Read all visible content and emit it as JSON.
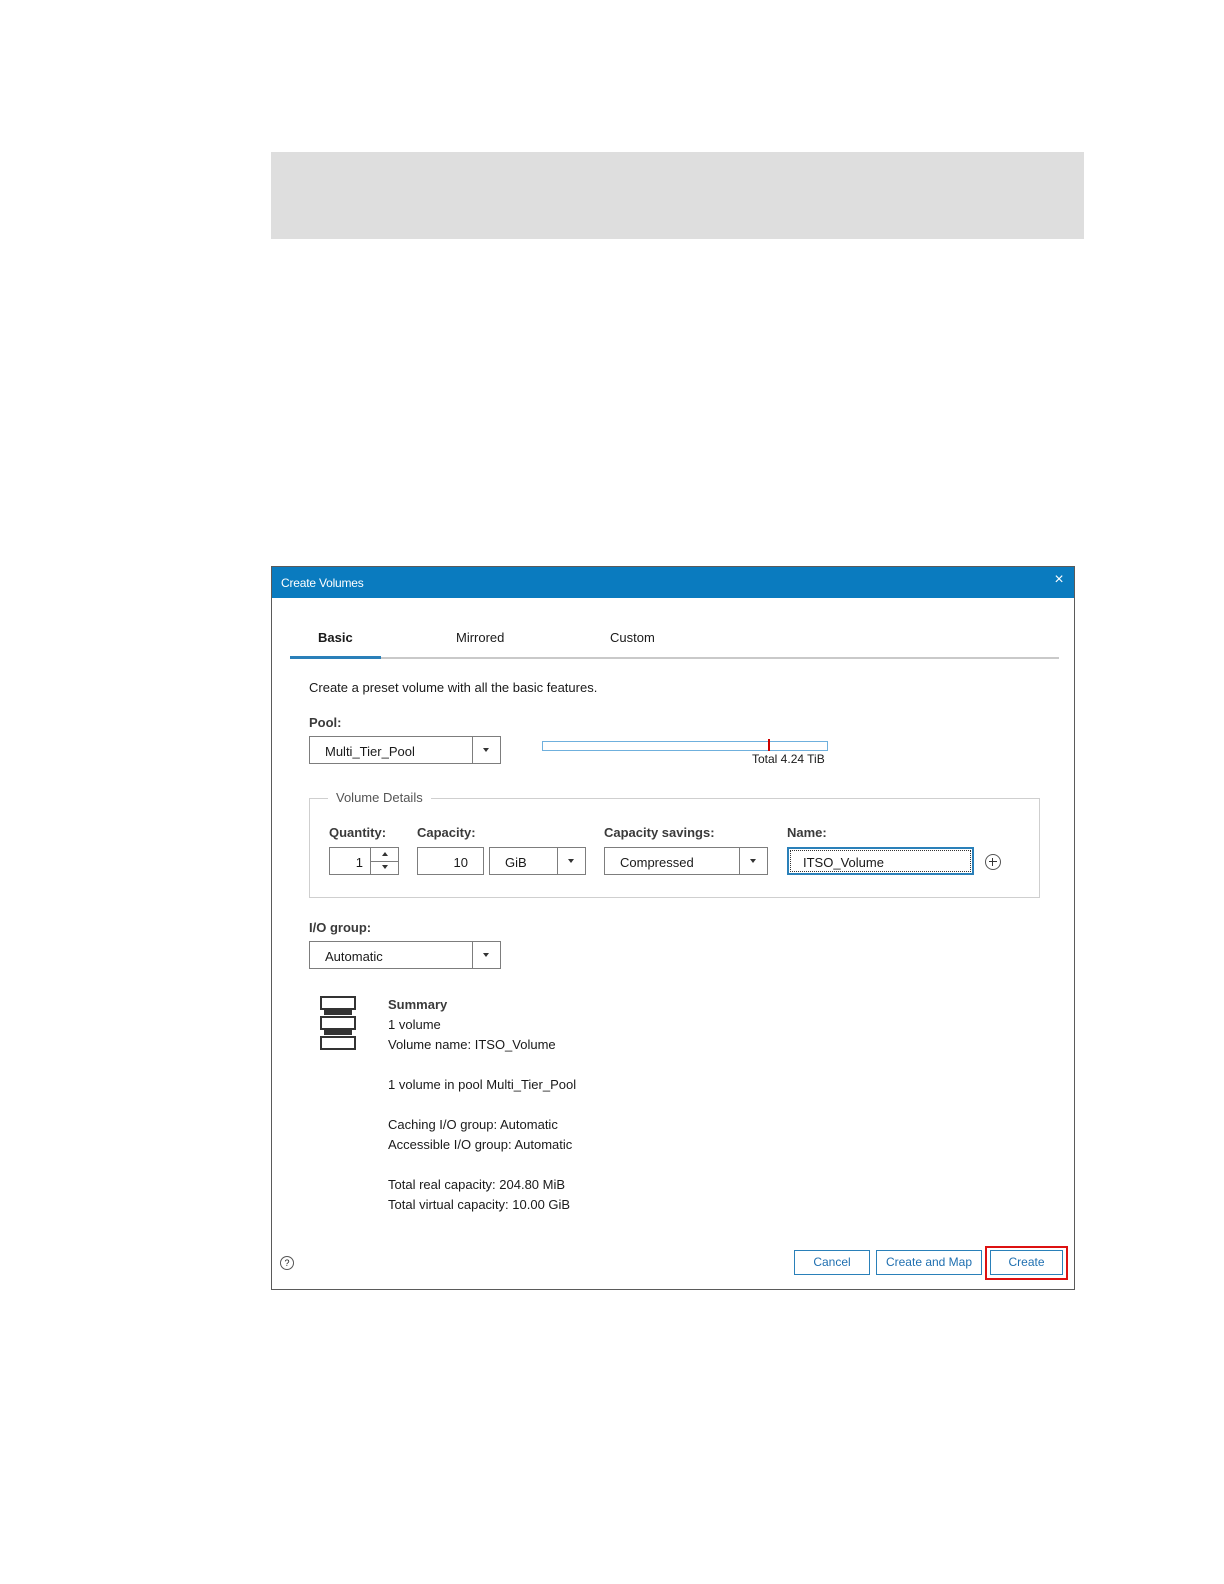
{
  "dialog": {
    "title": "Create Volumes",
    "close_label": "×"
  },
  "tabs": [
    {
      "label": "Basic",
      "active": true
    },
    {
      "label": "Mirrored",
      "active": false
    },
    {
      "label": "Custom",
      "active": false
    }
  ],
  "description": "Create a preset volume with all the basic features.",
  "pool": {
    "label": "Pool:",
    "value": "Multi_Tier_Pool",
    "capacity_text": "Total 4.24 TiB"
  },
  "volume_details": {
    "legend": "Volume Details",
    "quantity_label": "Quantity:",
    "quantity_value": "1",
    "capacity_label": "Capacity:",
    "capacity_value": "10",
    "capacity_unit": "GiB",
    "savings_label": "Capacity savings:",
    "savings_value": "Compressed",
    "name_label": "Name:",
    "name_value": "ITSO_Volume"
  },
  "io_group": {
    "label": "I/O group:",
    "value": "Automatic"
  },
  "summary": {
    "heading": "Summary",
    "lines": [
      "1 volume",
      "Volume name: ITSO_Volume",
      "1 volume in pool Multi_Tier_Pool",
      "Caching I/O group: Automatic",
      "Accessible I/O group: Automatic",
      "Total real capacity: 204.80 MiB",
      "Total virtual capacity: 10.00 GiB"
    ]
  },
  "footer": {
    "help_label": "?",
    "cancel_label": "Cancel",
    "create_map_label": "Create and Map",
    "create_label": "Create"
  },
  "colors": {
    "titlebar": "#0a7bbf",
    "accent": "#2a80b9",
    "highlight": "#dd1111"
  }
}
